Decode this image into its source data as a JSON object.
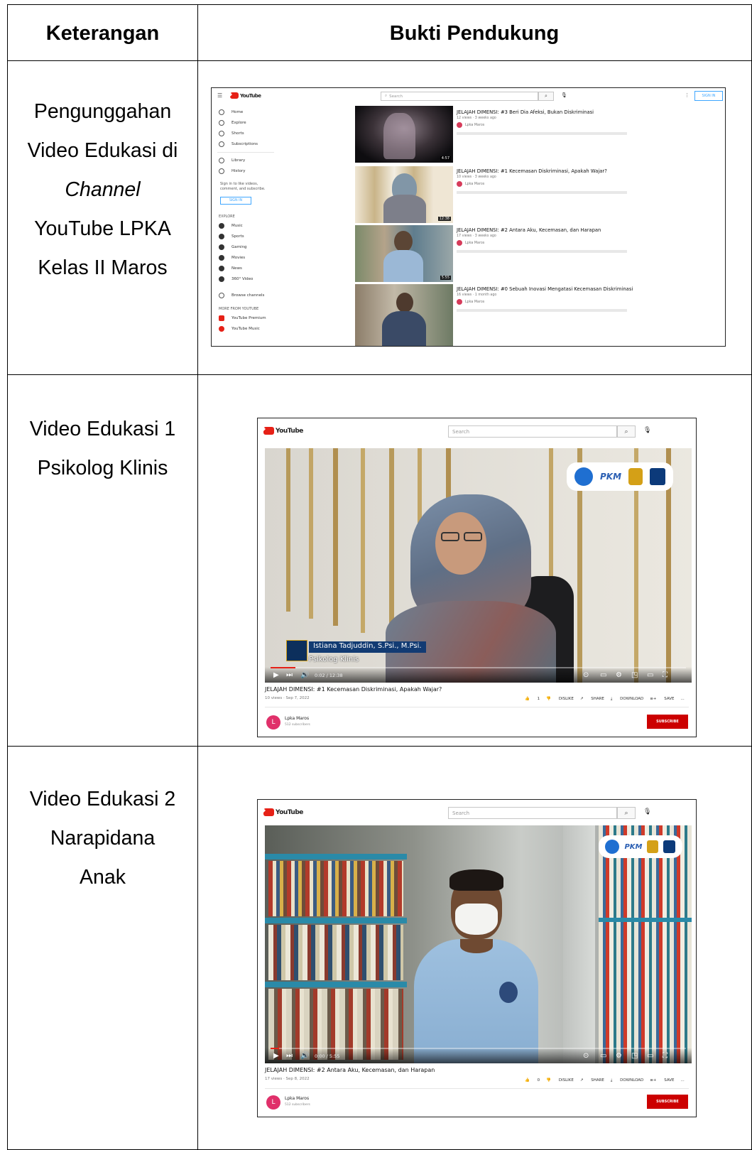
{
  "table": {
    "header": {
      "col1": "Keterangan",
      "col2": "Bukti Pendukung"
    },
    "rows": [
      {
        "lines": [
          "Pengunggahan",
          "Video Edukasi di",
          "Channel",
          "YouTube LPKA",
          "Kelas II Maros"
        ]
      },
      {
        "lines": [
          "Video Edukasi 1",
          "Psikolog Klinis"
        ]
      },
      {
        "lines": [
          "Video Edukasi 2",
          "Narapidana",
          "Anak"
        ]
      }
    ]
  },
  "youtube": {
    "logo_text": "YouTube",
    "search_placeholder": "Search",
    "sign_in": "SIGN IN"
  },
  "shot1": {
    "sidebar": [
      "Home",
      "Explore",
      "Shorts",
      "Subscriptions",
      "Library",
      "History"
    ],
    "signin_prompt": "Sign in to like videos, comment, and subscribe.",
    "explore_header": "EXPLORE",
    "explore_items": [
      "Music",
      "Sports",
      "Gaming",
      "Movies",
      "News",
      "360° Video"
    ],
    "browse_channels": "Browse channels",
    "more_header": "MORE FROM YOUTUBE",
    "more_items": [
      "YouTube Premium",
      "YouTube Music"
    ],
    "videos": [
      {
        "title": "JELAJAH DIMENSI: #3 Beri Dia Afeksi, Bukan Diskriminasi",
        "meta": "12 views · 3 weeks ago",
        "channel": "Lpka Maros",
        "duration": "4:57"
      },
      {
        "title": "JELAJAH DIMENSI: #1 Kecemasan Diskriminasi, Apakah Wajar?",
        "meta": "10 views · 3 weeks ago",
        "channel": "Lpka Maros",
        "duration": "12:38"
      },
      {
        "title": "JELAJAH DIMENSI: #2 Antara Aku, Kecemasan, dan Harapan",
        "meta": "17 views · 3 weeks ago",
        "channel": "Lpka Maros",
        "duration": "5:55"
      },
      {
        "title": "JELAJAH DIMENSI: #0 Sebuah Inovasi Mengatasi Kecemasan Diskriminasi",
        "meta": "16 views · 1 month ago",
        "channel": "Lpka Maros",
        "duration": ""
      }
    ]
  },
  "shot2": {
    "lower_third_name": "Istiana Tadjuddin, S.Psi., M.Psi.",
    "lower_third_role": "Psikolog Klinis",
    "time": "0:02 / 12:38",
    "title": "JELAJAH DIMENSI: #1 Kecemasan Diskriminasi, Apakah Wajar?",
    "meta": "10 views · Sep 7, 2022",
    "actions": [
      "1",
      "DISLIKE",
      "SHARE",
      "DOWNLOAD",
      "SAVE",
      "..."
    ],
    "channel": "Lpka Maros",
    "channel_initial": "L",
    "subs": "512 subscribers",
    "subscribe": "SUBSCRIBE"
  },
  "shot3": {
    "time": "0:00 / 5:55",
    "title": "JELAJAH DIMENSI: #2 Antara Aku, Kecemasan, dan Harapan",
    "meta": "17 views · Sep 8, 2022",
    "actions": [
      "0",
      "DISLIKE",
      "SHARE",
      "DOWNLOAD",
      "SAVE",
      "..."
    ],
    "channel": "Lpka Maros",
    "channel_initial": "L",
    "subs": "512 subscribers",
    "subscribe": "SUBSCRIBE"
  },
  "colors": {
    "youtube_red": "#e62117",
    "subscribe_red": "#cc0000",
    "table_border": "#000000"
  }
}
